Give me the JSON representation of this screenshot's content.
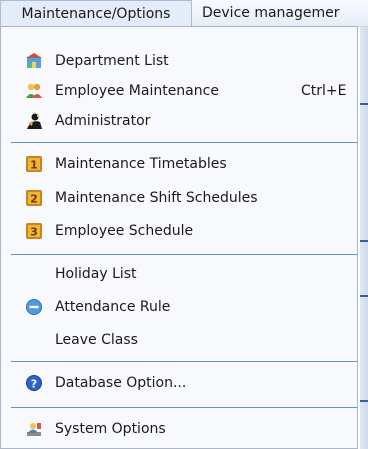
{
  "menubar": {
    "items": [
      "Maintenance/Options",
      "Device managemer"
    ]
  },
  "menu": {
    "items": [
      {
        "label": "Department List",
        "icon": "department-list-icon"
      },
      {
        "label": "Employee Maintenance",
        "icon": "employee-icon",
        "shortcut": "Ctrl+E"
      },
      {
        "label": "Administrator",
        "icon": "administrator-icon"
      },
      {
        "label": "Maintenance Timetables",
        "icon": "timetable-1-icon"
      },
      {
        "label": "Maintenance Shift Schedules",
        "icon": "shift-schedule-2-icon"
      },
      {
        "label": "Employee Schedule",
        "icon": "employee-schedule-3-icon"
      },
      {
        "label": "Holiday List"
      },
      {
        "label": "Attendance Rule",
        "icon": "attendance-rule-icon"
      },
      {
        "label": "Leave Class"
      },
      {
        "label": "Database Option...",
        "icon": "database-option-icon"
      },
      {
        "label": "System Options",
        "icon": "system-options-icon"
      }
    ]
  },
  "colors": {
    "menubar_bg": "#e6edf7",
    "separator": "#6c8fc3",
    "dropdown_bg": "#f7f9fc"
  }
}
